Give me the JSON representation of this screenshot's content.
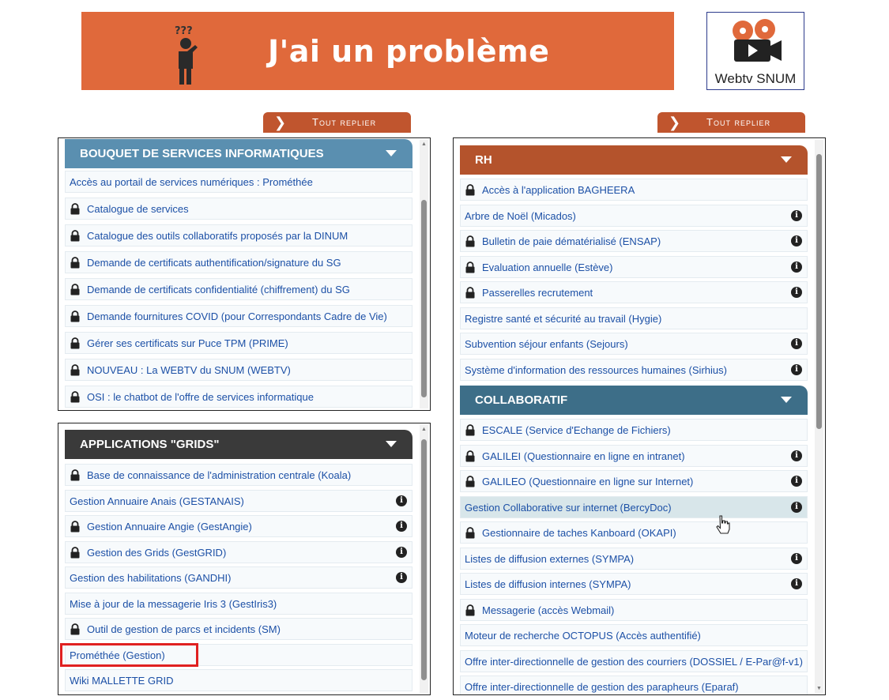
{
  "banner": {
    "title": "J'ai un problème",
    "bg_color": "#e0693b",
    "icon": "confused-person-icon"
  },
  "webtv": {
    "label": "Webtv SNUM",
    "icon": "film-camera-icon"
  },
  "collapse_label": "Tout replier",
  "left_top": {
    "header": "BOUQUET DE SERVICES INFORMATIQUES",
    "header_color": "#5a8fb0",
    "items": [
      {
        "label": "Accès au portail de services numériques : Prométhée",
        "lock": false,
        "info": false
      },
      {
        "label": "Catalogue de services",
        "lock": true,
        "info": false
      },
      {
        "label": "Catalogue des outils collaboratifs proposés par la DINUM",
        "lock": true,
        "info": false
      },
      {
        "label": "Demande de certificats authentification/signature du SG",
        "lock": true,
        "info": false
      },
      {
        "label": "Demande de certificats confidentialité (chiffrement) du SG",
        "lock": true,
        "info": false
      },
      {
        "label": "Demande fournitures COVID (pour Correspondants Cadre de Vie)",
        "lock": true,
        "info": false
      },
      {
        "label": "Gérer ses certificats sur Puce TPM (PRIME)",
        "lock": true,
        "info": false
      },
      {
        "label": "NOUVEAU : La WEBTV du SNUM (WEBTV)",
        "lock": true,
        "info": false
      },
      {
        "label": "OSI : le chatbot de l'offre de services informatique",
        "lock": true,
        "info": false
      }
    ]
  },
  "left_bottom": {
    "header": "APPLICATIONS \"GRIDS\"",
    "header_color": "#3a3a3a",
    "items": [
      {
        "label": "Base de connaissance de l'administration centrale (Koala)",
        "lock": true,
        "info": false
      },
      {
        "label": "Gestion Annuaire Anais (GESTANAIS)",
        "lock": false,
        "info": true
      },
      {
        "label": "Gestion Annuaire Angie (GestAngie)",
        "lock": true,
        "info": true
      },
      {
        "label": "Gestion des Grids (GestGRID)",
        "lock": true,
        "info": true
      },
      {
        "label": "Gestion des habilitations (GANDHI)",
        "lock": false,
        "info": true
      },
      {
        "label": "Mise à jour de la messagerie Iris 3 (GestIris3)",
        "lock": false,
        "info": false
      },
      {
        "label": "Outil de gestion de parcs et incidents (SM)",
        "lock": true,
        "info": false
      },
      {
        "label": "Prométhée (Gestion)",
        "lock": false,
        "info": false
      },
      {
        "label": "Wiki MALLETTE GRID",
        "lock": false,
        "info": false
      }
    ]
  },
  "right": {
    "rh_header": "RH",
    "rh_color": "#b4532c",
    "rh_items": [
      {
        "label": "Accès à l'application BAGHEERA",
        "lock": true,
        "info": false
      },
      {
        "label": "Arbre de Noël (Micados)",
        "lock": false,
        "info": true
      },
      {
        "label": "Bulletin de paie dématérialisé (ENSAP)",
        "lock": true,
        "info": true
      },
      {
        "label": "Evaluation annuelle (Estève)",
        "lock": true,
        "info": true
      },
      {
        "label": "Passerelles recrutement",
        "lock": true,
        "info": true
      },
      {
        "label": "Registre santé et sécurité au travail (Hygie)",
        "lock": false,
        "info": false
      },
      {
        "label": "Subvention séjour enfants (Sejours)",
        "lock": false,
        "info": true
      },
      {
        "label": "Système d'information des ressources humaines (Sirhius)",
        "lock": false,
        "info": true
      }
    ],
    "collab_header": "COLLABORATIF",
    "collab_color": "#3d6e88",
    "collab_items": [
      {
        "label": "ESCALE (Service d'Echange de Fichiers)",
        "lock": true,
        "info": false
      },
      {
        "label": "GALILEI (Questionnaire en ligne en intranet)",
        "lock": true,
        "info": true
      },
      {
        "label": "GALILEO (Questionnaire en ligne sur Internet)",
        "lock": true,
        "info": true
      },
      {
        "label": "Gestion Collaborative sur internet (BercyDoc)",
        "lock": false,
        "info": true
      },
      {
        "label": "Gestionnaire de taches Kanboard (OKAPI)",
        "lock": true,
        "info": false
      },
      {
        "label": "Listes de diffusion externes (SYMPA)",
        "lock": false,
        "info": true
      },
      {
        "label": "Listes de diffusion internes (SYMPA)",
        "lock": false,
        "info": true
      },
      {
        "label": "Messagerie (accès Webmail)",
        "lock": true,
        "info": false
      },
      {
        "label": "Moteur de recherche OCTOPUS (Accès authentifié)",
        "lock": false,
        "info": false
      },
      {
        "label": "Offre inter-directionnelle de gestion des courriers (DOSSIEL / E-Par@f-v1)",
        "lock": false,
        "info": false
      },
      {
        "label": "Offre inter-directionnelle de gestion des parapheurs (Eparaf)",
        "lock": false,
        "info": false
      }
    ]
  },
  "colors": {
    "link": "#1c50a6",
    "row_bg": "#f7fafc",
    "hover_bg": "#d8e6ea",
    "highlight_box": "#e02020"
  },
  "hovered_item": "Gestion Collaborative sur internet (BercyDoc)",
  "highlighted_item": "Prométhée (Gestion)"
}
